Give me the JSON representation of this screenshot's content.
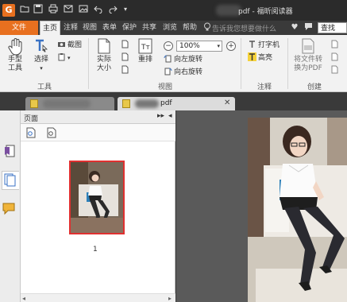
{
  "titlebar": {
    "app_logo": "G",
    "title": "pdf - 福昕阅读器",
    "quick_access": [
      "open-icon",
      "save-icon",
      "print-icon",
      "mail-icon",
      "image-icon",
      "undo-icon",
      "redo-icon",
      "dropdown-icon"
    ]
  },
  "menubar": {
    "file": "文件",
    "items": [
      "主页",
      "注释",
      "视图",
      "表单",
      "保护",
      "共享",
      "浏览",
      "帮助"
    ],
    "active": "主页",
    "tip": "告诉我您想要做什么",
    "search_label": "查找"
  },
  "ribbon": {
    "tools": {
      "hand": "手型\n工具",
      "select": "选择",
      "screenshot": "截图",
      "group": "工具"
    },
    "view": {
      "actual_size": "实际\n大小",
      "reflow": "重排",
      "zoom": "100%",
      "rotate_left": "向左旋转",
      "rotate_right": "向右旋转",
      "group": "视图"
    },
    "comment": {
      "typewriter": "打字机",
      "highlight": "高亮",
      "group": "注释"
    },
    "create": {
      "convert": "将文件转\n换为PDF",
      "group": "创建"
    }
  },
  "tabs": [
    {
      "label": "",
      "active": false
    },
    {
      "label": "pdf",
      "active": true
    }
  ],
  "panel": {
    "title": "页面",
    "thumbnails": [
      {
        "page": "1"
      }
    ]
  },
  "colors": {
    "accent": "#e8701f",
    "thumb_border": "#e03030"
  }
}
